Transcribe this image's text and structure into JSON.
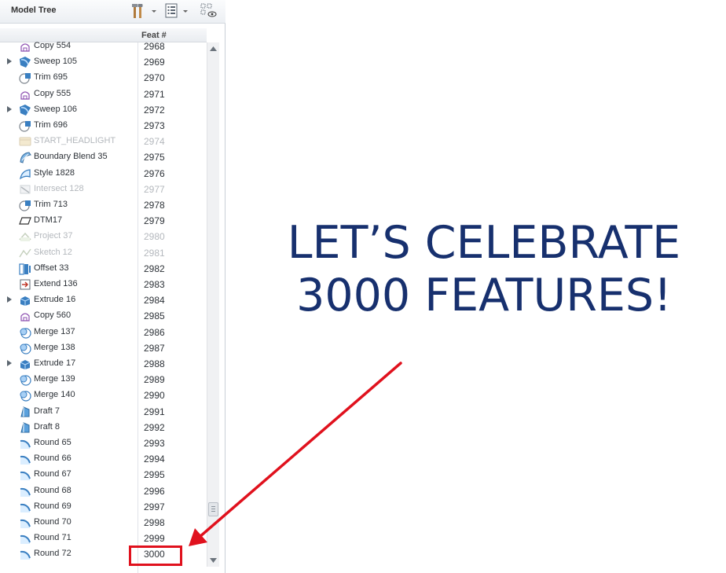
{
  "panel": {
    "title": "Model Tree",
    "toolbar": [
      {
        "name": "settings-tools-icon",
        "has_dropdown": true
      },
      {
        "name": "show-columns-icon",
        "has_dropdown": true
      },
      {
        "name": "tree-filters-icon",
        "has_dropdown": false
      }
    ],
    "column_header": "Feat #"
  },
  "rows": [
    {
      "name": "Copy 554",
      "num": "2968",
      "icon": "copy-icon",
      "expandable": false,
      "suppressed": false
    },
    {
      "name": "Sweep 105",
      "num": "2969",
      "icon": "sweep-icon",
      "expandable": true,
      "suppressed": false
    },
    {
      "name": "Trim 695",
      "num": "2970",
      "icon": "trim-icon",
      "expandable": false,
      "suppressed": false
    },
    {
      "name": "Copy 555",
      "num": "2971",
      "icon": "copy-icon",
      "expandable": false,
      "suppressed": false
    },
    {
      "name": "Sweep 106",
      "num": "2972",
      "icon": "sweep-icon",
      "expandable": true,
      "suppressed": false
    },
    {
      "name": "Trim 696",
      "num": "2973",
      "icon": "trim-icon",
      "expandable": false,
      "suppressed": false
    },
    {
      "name": "START_HEADLIGHT",
      "num": "2974",
      "icon": "group-icon",
      "expandable": false,
      "suppressed": true
    },
    {
      "name": "Boundary Blend 35",
      "num": "2975",
      "icon": "boundary-blend-icon",
      "expandable": false,
      "suppressed": false
    },
    {
      "name": "Style 1828",
      "num": "2976",
      "icon": "style-icon",
      "expandable": false,
      "suppressed": false
    },
    {
      "name": "Intersect 128",
      "num": "2977",
      "icon": "intersect-icon",
      "expandable": false,
      "suppressed": true
    },
    {
      "name": "Trim 713",
      "num": "2978",
      "icon": "trim-icon",
      "expandable": false,
      "suppressed": false
    },
    {
      "name": "DTM17",
      "num": "2979",
      "icon": "datum-plane-icon",
      "expandable": false,
      "suppressed": false
    },
    {
      "name": "Project 37",
      "num": "2980",
      "icon": "project-icon",
      "expandable": false,
      "suppressed": true
    },
    {
      "name": "Sketch 12",
      "num": "2981",
      "icon": "sketch-icon",
      "expandable": false,
      "suppressed": true
    },
    {
      "name": "Offset 33",
      "num": "2982",
      "icon": "offset-icon",
      "expandable": false,
      "suppressed": false
    },
    {
      "name": "Extend 136",
      "num": "2983",
      "icon": "extend-icon",
      "expandable": false,
      "suppressed": false
    },
    {
      "name": "Extrude 16",
      "num": "2984",
      "icon": "extrude-icon",
      "expandable": true,
      "suppressed": false
    },
    {
      "name": "Copy 560",
      "num": "2985",
      "icon": "copy-icon",
      "expandable": false,
      "suppressed": false
    },
    {
      "name": "Merge 137",
      "num": "2986",
      "icon": "merge-icon",
      "expandable": false,
      "suppressed": false
    },
    {
      "name": "Merge 138",
      "num": "2987",
      "icon": "merge-icon",
      "expandable": false,
      "suppressed": false
    },
    {
      "name": "Extrude 17",
      "num": "2988",
      "icon": "extrude-icon",
      "expandable": true,
      "suppressed": false
    },
    {
      "name": "Merge 139",
      "num": "2989",
      "icon": "merge-icon",
      "expandable": false,
      "suppressed": false
    },
    {
      "name": "Merge 140",
      "num": "2990",
      "icon": "merge-icon",
      "expandable": false,
      "suppressed": false
    },
    {
      "name": "Draft 7",
      "num": "2991",
      "icon": "draft-icon",
      "expandable": false,
      "suppressed": false
    },
    {
      "name": "Draft 8",
      "num": "2992",
      "icon": "draft-icon",
      "expandable": false,
      "suppressed": false
    },
    {
      "name": "Round 65",
      "num": "2993",
      "icon": "round-icon",
      "expandable": false,
      "suppressed": false
    },
    {
      "name": "Round 66",
      "num": "2994",
      "icon": "round-icon",
      "expandable": false,
      "suppressed": false
    },
    {
      "name": "Round 67",
      "num": "2995",
      "icon": "round-icon",
      "expandable": false,
      "suppressed": false
    },
    {
      "name": "Round 68",
      "num": "2996",
      "icon": "round-icon",
      "expandable": false,
      "suppressed": false
    },
    {
      "name": "Round 69",
      "num": "2997",
      "icon": "round-icon",
      "expandable": false,
      "suppressed": false
    },
    {
      "name": "Round 70",
      "num": "2998",
      "icon": "round-icon",
      "expandable": false,
      "suppressed": false
    },
    {
      "name": "Round 71",
      "num": "2999",
      "icon": "round-icon",
      "expandable": false,
      "suppressed": false
    },
    {
      "name": "Round 72",
      "num": "3000",
      "icon": "round-icon",
      "expandable": false,
      "suppressed": false
    }
  ],
  "headline": {
    "line1": "LET’S CELEBRATE",
    "line2": "3000 FEATURES!"
  },
  "colors": {
    "headline": "#17306e",
    "highlight": "#e0111d",
    "suppressed_text": "#b4b8bd",
    "icon_blue": "#3a7fc1"
  }
}
